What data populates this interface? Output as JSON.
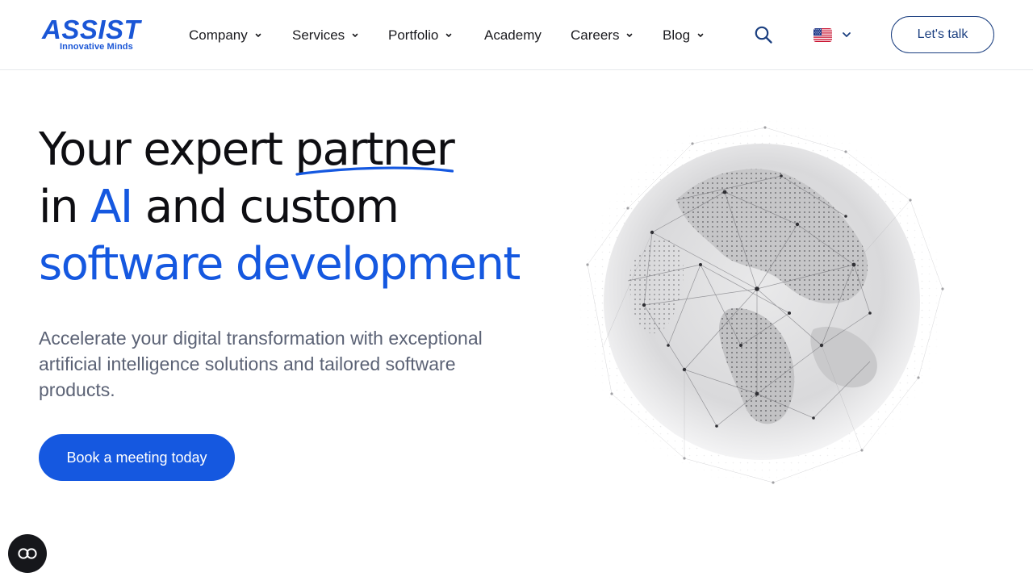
{
  "brand": {
    "logo_text": "ASSIST",
    "tagline": "Innovative Minds",
    "color": "#1a56d6"
  },
  "nav": {
    "items": [
      {
        "label": "Company",
        "has_dropdown": true
      },
      {
        "label": "Services",
        "has_dropdown": true
      },
      {
        "label": "Portfolio",
        "has_dropdown": true
      },
      {
        "label": "Academy",
        "has_dropdown": false
      },
      {
        "label": "Careers",
        "has_dropdown": true
      },
      {
        "label": "Blog",
        "has_dropdown": true
      }
    ],
    "search_icon": "search-icon",
    "language_flag": "us-flag-icon",
    "cta_label": "Let's talk"
  },
  "hero": {
    "title_part1": "Your expert ",
    "title_partner": "partner",
    "title_in": "in ",
    "title_ai": "AI",
    "title_custom": " and custom",
    "title_line3": "software development",
    "subtitle": "Accelerate your digital transformation with exceptional artificial intelligence solutions and tailored software products.",
    "cta_label": "Book a meeting today",
    "accent_color": "#1558e0",
    "illustration": "wireframe-globe-image"
  },
  "widgets": {
    "accessibility_icon": "accessibility-icon"
  }
}
